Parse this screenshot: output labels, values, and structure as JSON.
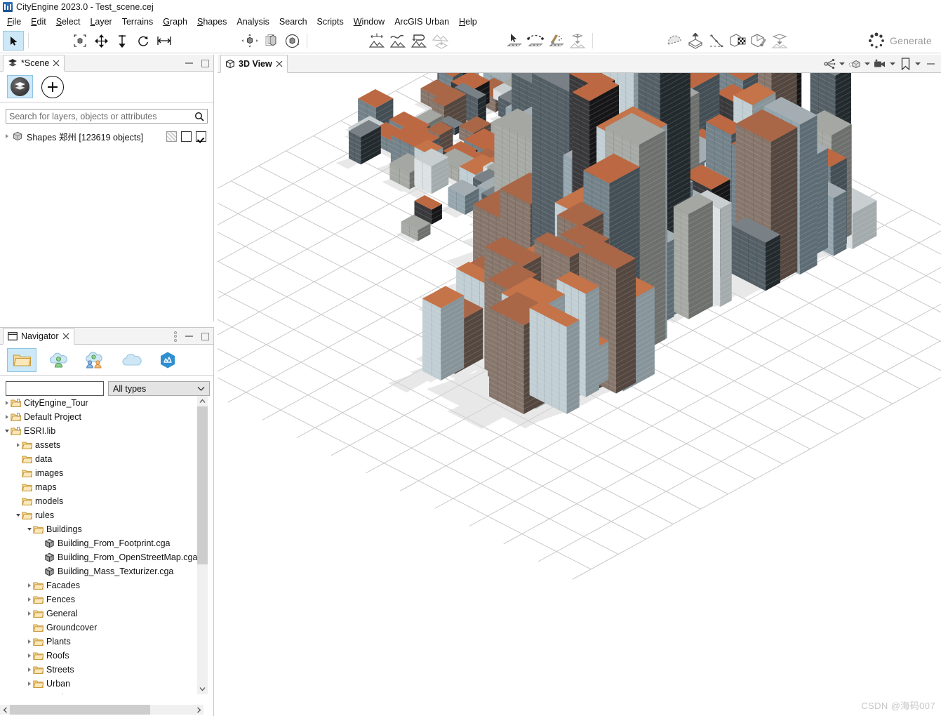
{
  "window": {
    "title": "CityEngine 2023.0 - Test_scene.cej",
    "app_icon": "cityengine-icon"
  },
  "menubar": {
    "items": [
      {
        "label": "File",
        "mnemonic": "F"
      },
      {
        "label": "Edit",
        "mnemonic": "E"
      },
      {
        "label": "Select",
        "mnemonic": "S"
      },
      {
        "label": "Layer",
        "mnemonic": "L"
      },
      {
        "label": "Terrains",
        "mnemonic": ""
      },
      {
        "label": "Graph",
        "mnemonic": "G"
      },
      {
        "label": "Shapes",
        "mnemonic": "S"
      },
      {
        "label": "Analysis",
        "mnemonic": ""
      },
      {
        "label": "Search",
        "mnemonic": ""
      },
      {
        "label": "Scripts",
        "mnemonic": ""
      },
      {
        "label": "Window",
        "mnemonic": "W"
      },
      {
        "label": "ArcGIS Urban",
        "mnemonic": ""
      },
      {
        "label": "Help",
        "mnemonic": "H"
      }
    ]
  },
  "toolbar": {
    "generate_label": "Generate",
    "buttons": [
      {
        "name": "select-tool",
        "selected": true
      },
      {
        "name": "scale-tool",
        "selected": false
      },
      {
        "name": "move-tool",
        "selected": false
      },
      {
        "name": "push-pull-tool",
        "selected": false
      },
      {
        "name": "rotate-tool",
        "selected": false
      },
      {
        "name": "stretch-tool",
        "selected": false
      },
      {
        "name": "navigate-tool",
        "selected": false
      },
      {
        "name": "layers-tool",
        "selected": false
      },
      {
        "name": "orbit-tool",
        "selected": false
      },
      {
        "name": "terrain-offset-tool",
        "selected": false
      },
      {
        "name": "terrain-smooth-tool",
        "selected": false
      },
      {
        "name": "terrain-flatten-tool",
        "selected": false
      },
      {
        "name": "terrain-align-tool",
        "selected": false
      },
      {
        "name": "street-select-tool",
        "selected": false
      },
      {
        "name": "street-curve-tool",
        "selected": false
      },
      {
        "name": "street-clean-tool",
        "selected": false
      },
      {
        "name": "street-align-terrain-tool",
        "selected": false
      },
      {
        "name": "shape-create-tool",
        "selected": false
      },
      {
        "name": "shape-extrude-tool",
        "selected": false
      },
      {
        "name": "measure-tool",
        "selected": false
      },
      {
        "name": "texture-tool",
        "selected": false
      },
      {
        "name": "cleanup-shapes-tool",
        "selected": false
      },
      {
        "name": "align-shapes-terrain-tool",
        "selected": false
      },
      {
        "name": "generate-button",
        "selected": false
      },
      {
        "name": "cga-rule-tool",
        "selected": false
      },
      {
        "name": "random-seed-tool",
        "selected": false
      }
    ]
  },
  "scene_panel": {
    "tab_label": "*Scene",
    "tab_icon": "layers-icon",
    "close_icon": "close-icon",
    "minimize_icon": "minimize-icon",
    "maximize_icon": "maximize-icon",
    "layers_button_icon": "layers-sphere-icon",
    "add_button_icon": "plus-icon",
    "search": {
      "placeholder": "Search for layers, objects or attributes",
      "value": "",
      "icon": "search-icon"
    },
    "layers": [
      {
        "name": "Shapes 郑州 [123619 objects]",
        "icon": "shapes-cube-icon",
        "expanded": false,
        "hatch_state": "partial",
        "lock_state": "unlocked",
        "visible": true
      }
    ]
  },
  "navigator_panel": {
    "tab_label": "Navigator",
    "tab_icon": "folder-window-icon",
    "close_icon": "close-icon",
    "menu_icon": "view-menu-icon",
    "minimize_icon": "minimize-icon",
    "maximize_icon": "maximize-icon",
    "toolbar_icons": [
      {
        "name": "local-folder-icon",
        "selected": true
      },
      {
        "name": "my-content-cloud-icon",
        "selected": false
      },
      {
        "name": "shared-content-cloud-icon",
        "selected": false
      },
      {
        "name": "cloud-icon",
        "selected": false
      },
      {
        "name": "arcgis-online-icon",
        "selected": false
      }
    ],
    "search": {
      "value": "",
      "placeholder": "",
      "icon": "search-icon"
    },
    "type_filter": {
      "value": "All types",
      "icon": "chevron-down-icon"
    },
    "tree": [
      {
        "label": "CityEngine_Tour",
        "depth": 0,
        "icon": "project-folder-icon",
        "state": "collapsed"
      },
      {
        "label": "Default Project",
        "depth": 0,
        "icon": "project-folder-icon",
        "state": "collapsed"
      },
      {
        "label": "ESRI.lib",
        "depth": 0,
        "icon": "library-folder-icon",
        "state": "expanded"
      },
      {
        "label": "assets",
        "depth": 1,
        "icon": "folder-icon",
        "state": "collapsed"
      },
      {
        "label": "data",
        "depth": 1,
        "icon": "folder-icon",
        "state": "leaf"
      },
      {
        "label": "images",
        "depth": 1,
        "icon": "folder-icon",
        "state": "leaf"
      },
      {
        "label": "maps",
        "depth": 1,
        "icon": "folder-icon",
        "state": "leaf"
      },
      {
        "label": "models",
        "depth": 1,
        "icon": "folder-icon",
        "state": "leaf"
      },
      {
        "label": "rules",
        "depth": 1,
        "icon": "folder-icon",
        "state": "expanded"
      },
      {
        "label": "Buildings",
        "depth": 2,
        "icon": "folder-icon",
        "state": "expanded"
      },
      {
        "label": "Building_From_Footprint.cga",
        "depth": 3,
        "icon": "cga-file-icon",
        "state": "file"
      },
      {
        "label": "Building_From_OpenStreetMap.cga",
        "depth": 3,
        "icon": "cga-file-icon",
        "state": "file"
      },
      {
        "label": "Building_Mass_Texturizer.cga",
        "depth": 3,
        "icon": "cga-file-icon",
        "state": "file"
      },
      {
        "label": "Facades",
        "depth": 2,
        "icon": "folder-icon",
        "state": "collapsed"
      },
      {
        "label": "Fences",
        "depth": 2,
        "icon": "folder-icon",
        "state": "collapsed"
      },
      {
        "label": "General",
        "depth": 2,
        "icon": "folder-icon",
        "state": "collapsed"
      },
      {
        "label": "Groundcover",
        "depth": 2,
        "icon": "folder-icon",
        "state": "leaf"
      },
      {
        "label": "Plants",
        "depth": 2,
        "icon": "folder-icon",
        "state": "collapsed"
      },
      {
        "label": "Roofs",
        "depth": 2,
        "icon": "folder-icon",
        "state": "collapsed"
      },
      {
        "label": "Streets",
        "depth": 2,
        "icon": "folder-icon",
        "state": "collapsed"
      },
      {
        "label": "Urban",
        "depth": 2,
        "icon": "folder-icon",
        "state": "collapsed"
      },
      {
        "label": "Zoning",
        "depth": 2,
        "icon": "folder-icon",
        "state": "collapsed"
      }
    ]
  },
  "view3d": {
    "tab_label": "3D View",
    "tab_icon": "cube-icon",
    "close_icon": "close-icon",
    "tools": [
      {
        "name": "share-view-icon",
        "has_dropdown": true
      },
      {
        "name": "model-display-icon",
        "has_dropdown": true
      },
      {
        "name": "camera-icon",
        "has_dropdown": true
      },
      {
        "name": "bookmark-icon",
        "has_dropdown": true
      },
      {
        "name": "minimize-icon",
        "has_dropdown": false
      }
    ],
    "watermark": "CSDN @海码007",
    "scene": {
      "background": "#ffffff",
      "grid_color": "#b9b9b9",
      "shadow_color": "#d6d6d6",
      "description": "Isometric 3D city model of textured high-rise buildings on a white ground plane with a perspective grid"
    }
  },
  "colors": {
    "accent_selection": "#cde8f7",
    "accent_border": "#8fc4e2",
    "panel_bg": "#ffffff",
    "tabbar_bg": "#f3f3f3",
    "border": "#c8c8c8",
    "folder_fill": "#f5c77e",
    "folder_stroke": "#c98b28",
    "scrollbar_thumb": "#cdcdcd",
    "scrollbar_track": "#f0f0f0",
    "watermark": "#c6c6c6"
  }
}
